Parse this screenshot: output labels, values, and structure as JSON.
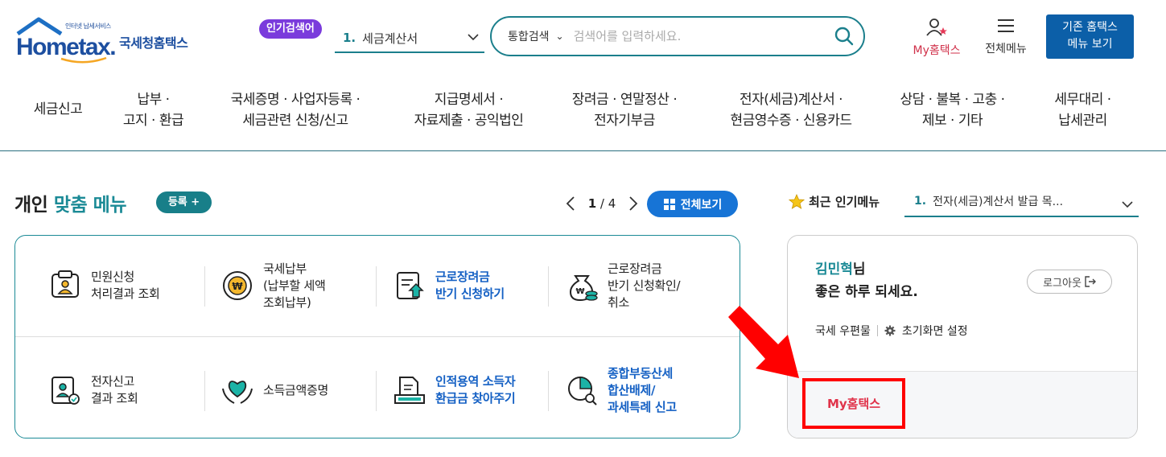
{
  "header": {
    "logo_tagline": "인터넷 납세서비스",
    "logo_text": "Hometax.",
    "logo_subtitle": "국세청홈택스",
    "hot_search_badge": "인기검색어",
    "hot_search_rank": "1.",
    "hot_search_item": "세금계산서",
    "search_scope": "통합검색",
    "search_placeholder": "검색어를 입력하세요.",
    "my_hometax_label": "My홈택스",
    "all_menu_label": "전체메뉴",
    "legacy_button_line1": "기존 홈택스",
    "legacy_button_line2": "메뉴 보기"
  },
  "nav": {
    "items": [
      {
        "line1": "세금신고",
        "line2": ""
      },
      {
        "line1": "납부 ·",
        "line2": "고지 · 환급"
      },
      {
        "line1": "국세증명 · 사업자등록 ·",
        "line2": "세금관련 신청/신고"
      },
      {
        "line1": "지급명세서 ·",
        "line2": "자료제출 · 공익법인"
      },
      {
        "line1": "장려금 · 연말정산 ·",
        "line2": "전자기부금"
      },
      {
        "line1": "전자(세금)계산서 ·",
        "line2": "현금영수증 · 신용카드"
      },
      {
        "line1": "상담 · 불복 · 고충 ·",
        "line2": "제보 · 기타"
      },
      {
        "line1": "세무대리 ·",
        "line2": "납세관리"
      }
    ]
  },
  "custom_menu": {
    "title_prefix": "개인",
    "title_accent": "맞춤 메뉴",
    "register_label": "등록 +",
    "page_current": "1",
    "page_sep": "/",
    "page_total": "4",
    "view_all_label": "전체보기",
    "tiles": [
      {
        "label": "민원신청\n처리결과 조회",
        "highlight": false,
        "icon": "document-person-icon"
      },
      {
        "label": "국세납부\n(납부할 세액\n조회납부)",
        "highlight": false,
        "icon": "won-coin-icon"
      },
      {
        "label": "근로장려금\n반기 신청하기",
        "highlight": true,
        "icon": "clipboard-upload-icon"
      },
      {
        "label": "근로장려금\n반기 신청확인/\n취소",
        "highlight": false,
        "icon": "money-bag-icon"
      },
      {
        "label": "전자신고\n결과 조회",
        "highlight": false,
        "icon": "certificate-icon"
      },
      {
        "label": "소득금액증명",
        "highlight": false,
        "icon": "heart-hands-icon"
      },
      {
        "label": "인적용역 소득자\n환급금 찾아주기",
        "highlight": true,
        "icon": "refund-document-icon"
      },
      {
        "label": "종합부동산세\n합산배제/\n과세특례 신고",
        "highlight": true,
        "icon": "chart-search-icon"
      }
    ]
  },
  "popular_menu": {
    "label": "최근 인기메뉴",
    "rank": "1.",
    "item": "전자(세금)계산서 발급 목..."
  },
  "user_panel": {
    "name": "김민혁",
    "name_suffix": "님",
    "greeting": "좋은 하루 되세요.",
    "logout_label": "로그아웃",
    "mail_label": "국세 우편물",
    "settings_label": "초기화면 설정",
    "my_hometax_label": "My홈택스"
  },
  "colors": {
    "teal": "#1b8a96",
    "blue_button": "#1774d6",
    "legacy_button": "#0c5fa8",
    "hot_badge": "#7a3bdc",
    "highlight_red": "#ff0000"
  }
}
